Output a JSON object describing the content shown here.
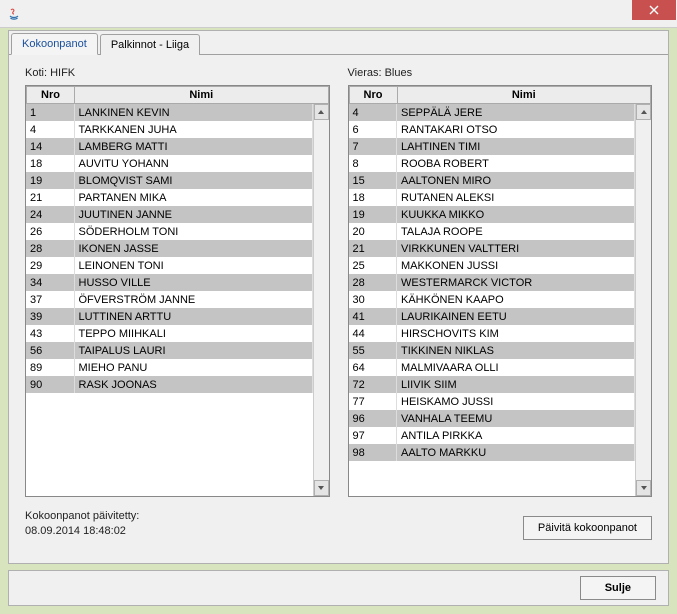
{
  "tabs": {
    "kokoonpanot": "Kokoonpanot",
    "palkinnot": "Palkinnot - Liiga"
  },
  "home": {
    "label": "Koti: HIFK",
    "headers": {
      "nro": "Nro",
      "nimi": "Nimi"
    },
    "rows": [
      {
        "nro": "1",
        "nimi": "LANKINEN KEVIN",
        "shade": true
      },
      {
        "nro": "4",
        "nimi": "TARKKANEN JUHA",
        "shade": false
      },
      {
        "nro": "14",
        "nimi": "LAMBERG MATTI",
        "shade": true
      },
      {
        "nro": "18",
        "nimi": "AUVITU YOHANN",
        "shade": false
      },
      {
        "nro": "19",
        "nimi": "BLOMQVIST SAMI",
        "shade": true
      },
      {
        "nro": "21",
        "nimi": "PARTANEN MIKA",
        "shade": false
      },
      {
        "nro": "24",
        "nimi": "JUUTINEN JANNE",
        "shade": true
      },
      {
        "nro": "26",
        "nimi": "SÖDERHOLM TONI",
        "shade": false
      },
      {
        "nro": "28",
        "nimi": "IKONEN JASSE",
        "shade": true
      },
      {
        "nro": "29",
        "nimi": "LEINONEN TONI",
        "shade": false
      },
      {
        "nro": "34",
        "nimi": "HUSSO VILLE",
        "shade": true
      },
      {
        "nro": "37",
        "nimi": "ÖFVERSTRÖM JANNE",
        "shade": false
      },
      {
        "nro": "39",
        "nimi": "LUTTINEN ARTTU",
        "shade": true
      },
      {
        "nro": "43",
        "nimi": "TEPPO MIIHKALI",
        "shade": false
      },
      {
        "nro": "56",
        "nimi": "TAIPALUS LAURI",
        "shade": true
      },
      {
        "nro": "89",
        "nimi": "MIEHO PANU",
        "shade": false
      },
      {
        "nro": "90",
        "nimi": "RASK JOONAS",
        "shade": true
      }
    ]
  },
  "away": {
    "label": "Vieras: Blues",
    "headers": {
      "nro": "Nro",
      "nimi": "Nimi"
    },
    "rows": [
      {
        "nro": "4",
        "nimi": "SEPPÄLÄ JERE",
        "shade": true
      },
      {
        "nro": "6",
        "nimi": "RANTAKARI OTSO",
        "shade": false
      },
      {
        "nro": "7",
        "nimi": "LAHTINEN TIMI",
        "shade": true
      },
      {
        "nro": "8",
        "nimi": "ROOBA ROBERT",
        "shade": false
      },
      {
        "nro": "15",
        "nimi": "AALTONEN MIRO",
        "shade": true
      },
      {
        "nro": "18",
        "nimi": "RUTANEN ALEKSI",
        "shade": false
      },
      {
        "nro": "19",
        "nimi": "KUUKKA MIKKO",
        "shade": true
      },
      {
        "nro": "20",
        "nimi": "TALAJA ROOPE",
        "shade": false
      },
      {
        "nro": "21",
        "nimi": "VIRKKUNEN VALTTERI",
        "shade": true
      },
      {
        "nro": "25",
        "nimi": "MAKKONEN JUSSI",
        "shade": false
      },
      {
        "nro": "28",
        "nimi": "WESTERMARCK VICTOR",
        "shade": true
      },
      {
        "nro": "30",
        "nimi": "KÄHKÖNEN KAAPO",
        "shade": false
      },
      {
        "nro": "41",
        "nimi": "LAURIKAINEN EETU",
        "shade": true
      },
      {
        "nro": "44",
        "nimi": "HIRSCHOVITS KIM",
        "shade": false
      },
      {
        "nro": "55",
        "nimi": "TIKKINEN NIKLAS",
        "shade": true
      },
      {
        "nro": "64",
        "nimi": "MALMIVAARA OLLI",
        "shade": false
      },
      {
        "nro": "72",
        "nimi": "LIIVIK SIIM",
        "shade": true
      },
      {
        "nro": "77",
        "nimi": "HEISKAMO JUSSI",
        "shade": false
      },
      {
        "nro": "96",
        "nimi": "VANHALA TEEMU",
        "shade": true
      },
      {
        "nro": "97",
        "nimi": "ANTILA PIRKKA",
        "shade": false
      },
      {
        "nro": "98",
        "nimi": "AALTO MARKKU",
        "shade": true
      }
    ]
  },
  "updated": {
    "label": "Kokoonpanot päivitetty:",
    "value": "08.09.2014 18:48:02"
  },
  "buttons": {
    "refresh": "Päivitä kokoonpanot",
    "close": "Sulje"
  }
}
